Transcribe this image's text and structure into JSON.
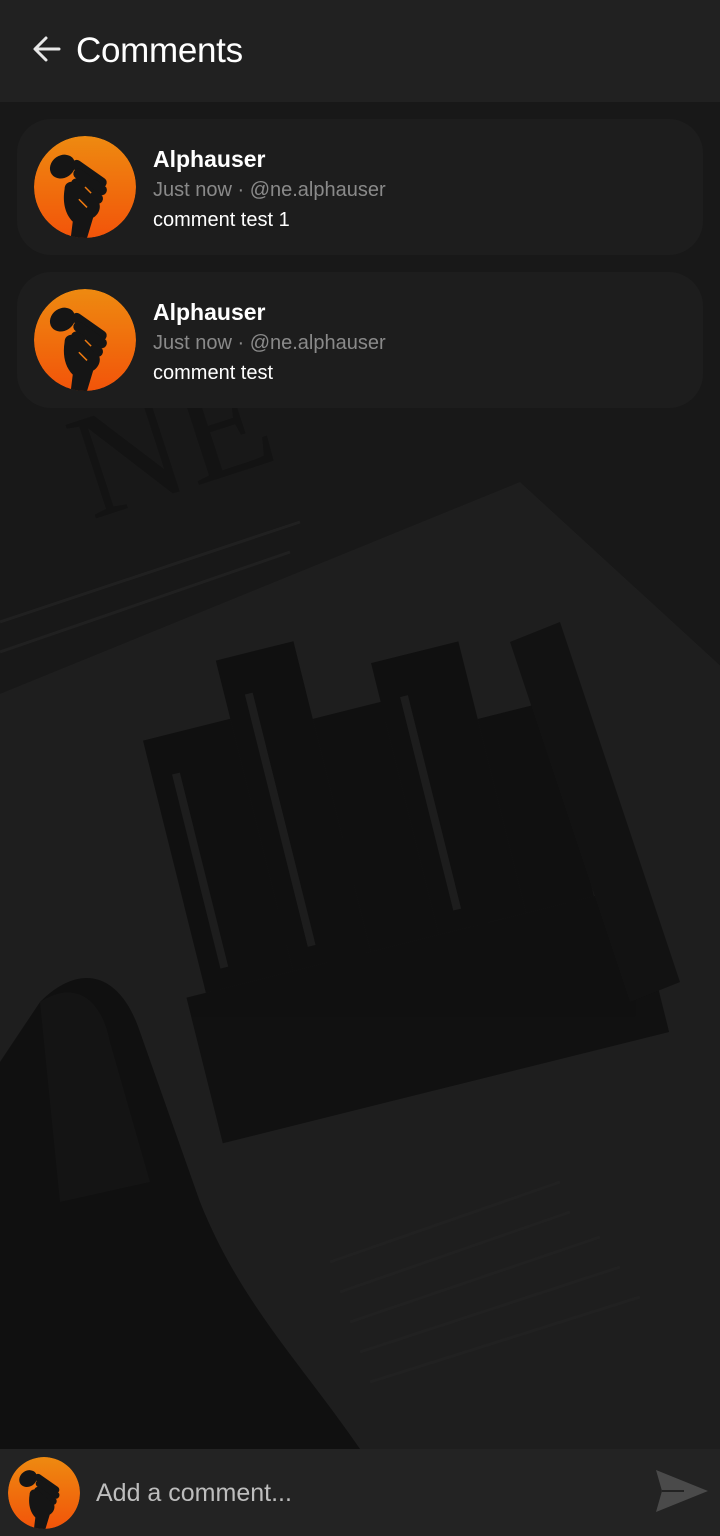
{
  "header": {
    "back_icon": "arrow-left-icon",
    "title": "Comments"
  },
  "comments": [
    {
      "author": "Alphauser",
      "meta": "Just now · @ne.alphauser",
      "text": "comment test 1",
      "avatar_icon": "raised-fist-microphone-icon"
    },
    {
      "author": "Alphauser",
      "meta": "Just now · @ne.alphauser",
      "text": "comment test",
      "avatar_icon": "raised-fist-microphone-icon"
    }
  ],
  "composer": {
    "placeholder": "Add a comment...",
    "send_icon": "send-icon"
  },
  "colors": {
    "header_bg": "#212121",
    "card_bg": "#1d1d1d",
    "avatar_orange_top": "#ee8a10",
    "avatar_orange_bottom": "#f2540a",
    "meta_text": "#8a8a8a"
  }
}
